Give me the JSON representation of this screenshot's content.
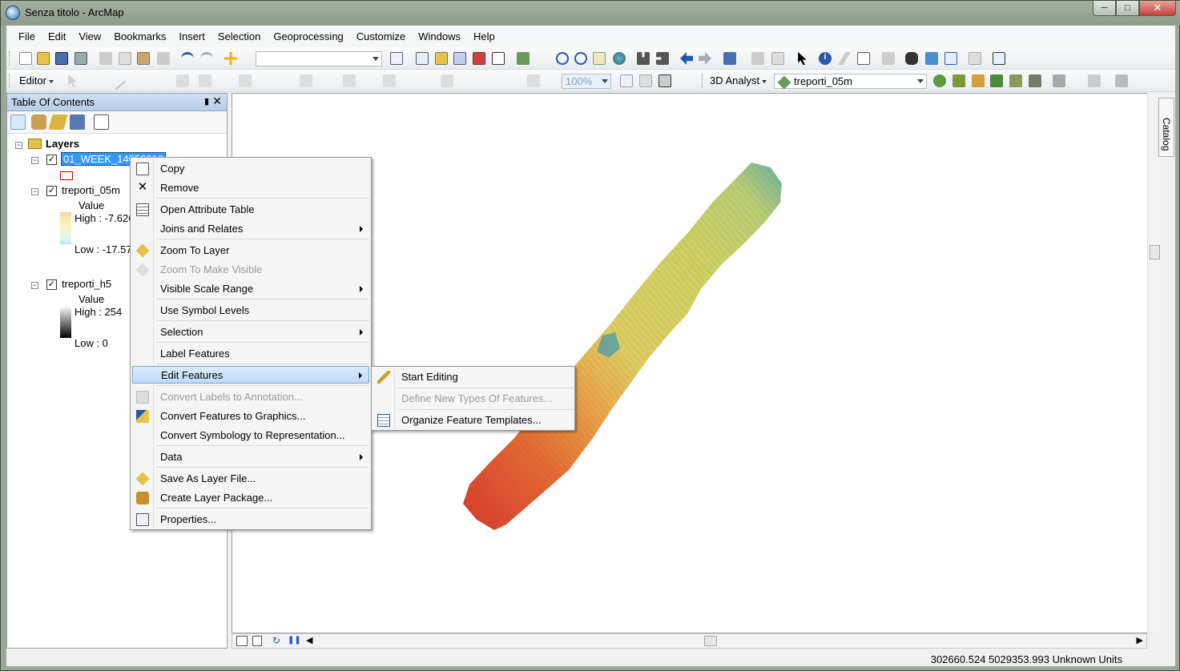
{
  "window": {
    "title": "Senza titolo - ArcMap"
  },
  "menubar": [
    "File",
    "Edit",
    "View",
    "Bookmarks",
    "Insert",
    "Selection",
    "Geoprocessing",
    "Customize",
    "Windows",
    "Help"
  ],
  "toolbar": {
    "editor_label": "Editor",
    "zoom_value": "100%",
    "analyst_label": "3D Analyst",
    "layer_combo": "treporti_05m"
  },
  "toc": {
    "title": "Table Of Contents",
    "root": "Layers",
    "layers": [
      {
        "name": "01_WEEK_14052013"
      },
      {
        "name": "treporti_05m",
        "value_label": "Value",
        "high": "High : -7.626",
        "low": "Low : -17.576"
      },
      {
        "name": "treporti_h5",
        "value_label": "Value",
        "high": "High : 254",
        "low": "Low : 0"
      }
    ]
  },
  "context_menu": {
    "items": [
      {
        "label": "Copy",
        "icon": "copy-icon"
      },
      {
        "label": "Remove",
        "icon": "remove-icon"
      },
      {
        "label": "Open Attribute Table",
        "icon": "table-icon"
      },
      {
        "label": "Joins and Relates"
      },
      {
        "label": "Zoom To Layer",
        "icon": "zoom-layer-icon"
      },
      {
        "label": "Zoom To Make Visible",
        "icon": "zoom-visible-icon"
      },
      {
        "label": "Visible Scale Range"
      },
      {
        "label": "Use Symbol Levels"
      },
      {
        "label": "Selection"
      },
      {
        "label": "Label Features"
      },
      {
        "label": "Edit Features"
      },
      {
        "label": "Convert Labels to Annotation...",
        "icon": "annotation-icon"
      },
      {
        "label": "Convert Features to Graphics...",
        "icon": "graphics-icon"
      },
      {
        "label": "Convert Symbology to Representation..."
      },
      {
        "label": "Data"
      },
      {
        "label": "Save As Layer File...",
        "icon": "layer-file-icon"
      },
      {
        "label": "Create Layer Package...",
        "icon": "package-icon"
      },
      {
        "label": "Properties...",
        "icon": "properties-icon"
      }
    ]
  },
  "submenu": {
    "items": [
      {
        "label": "Start Editing",
        "icon": "pencil-icon"
      },
      {
        "label": "Define New Types Of Features..."
      },
      {
        "label": "Organize Feature Templates...",
        "icon": "templates-icon"
      }
    ]
  },
  "catalog_tab": "Catalog",
  "status": {
    "coordinates": "302660.524  5029353.993 Unknown Units"
  },
  "colors": {
    "highlight": "#3399ff",
    "menu_hover": "#c1dbfc",
    "ramp_high": "#d73027",
    "ramp_mid": "#d9d760",
    "ramp_low": "#2c9fb0"
  }
}
